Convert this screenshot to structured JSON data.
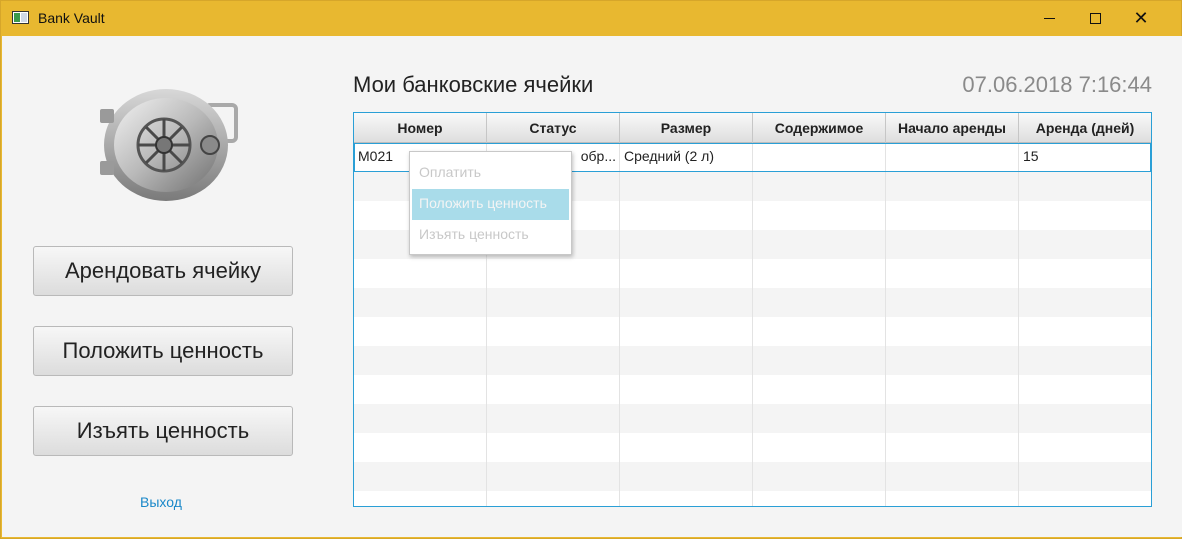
{
  "window": {
    "title": "Bank Vault"
  },
  "sidebar": {
    "buttons": [
      "Арендовать ячейку",
      "Положить ценность",
      "Изъять ценность"
    ],
    "exit_link": "Выход"
  },
  "main": {
    "heading": "Мои банковские ячейки",
    "clock": "07.06.2018 7:16:44"
  },
  "table": {
    "columns": [
      "Номер",
      "Статус",
      "Размер",
      "Содержимое",
      "Начало аренды",
      "Аренда (дней)"
    ],
    "rows": [
      {
        "cells": [
          "M021",
          "Ожидает обработки",
          "Средний (2 л)",
          "",
          "",
          "15"
        ]
      }
    ],
    "visible_status_fragment": "обр..."
  },
  "context_menu": {
    "items": [
      "Оплатить",
      "Положить ценность",
      "Изъять ценность"
    ],
    "highlighted": "Положить ценность"
  },
  "colors": {
    "title_bar": "#e8b830",
    "table_border": "#2a9fd6",
    "link": "#1a88c9",
    "menu_highlight": "#a9dcea"
  }
}
